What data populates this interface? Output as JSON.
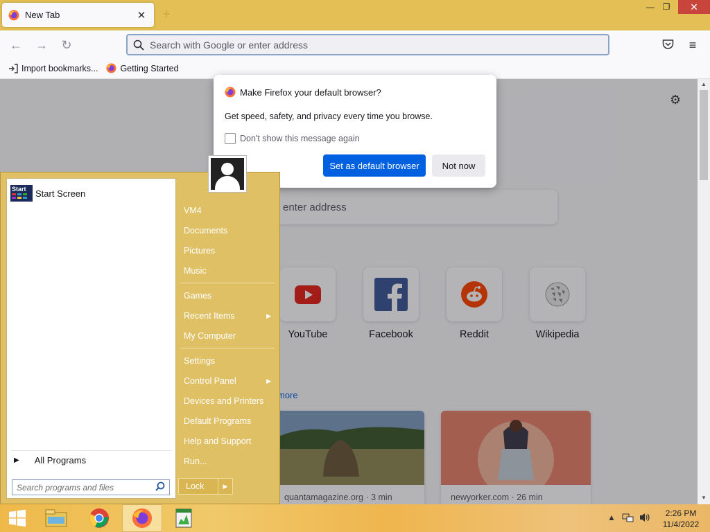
{
  "browser": {
    "tab_title": "New Tab",
    "tab_close": "✕",
    "new_tab": "+",
    "window_controls": {
      "minimize": "—",
      "restore": "❐",
      "close": "✕"
    },
    "nav": {
      "back": "←",
      "forward": "→",
      "reload": "↻",
      "pocket": "pocket-icon",
      "menu": "≡"
    },
    "urlbar_placeholder": "Search with Google or enter address",
    "bookmarks": [
      {
        "label": "Import bookmarks...",
        "icon": "import-icon"
      },
      {
        "label": "Getting Started",
        "icon": "firefox-icon"
      }
    ]
  },
  "newtab": {
    "search_placeholder": "enter address",
    "sites": [
      {
        "label": "YouTube",
        "color": "#e62117"
      },
      {
        "label": "Facebook",
        "color": "#3b5998"
      },
      {
        "label": "Reddit",
        "color": "#ff4500"
      },
      {
        "label": "Wikipedia",
        "color": "#777777"
      }
    ],
    "more_link": "more",
    "cards": [
      {
        "source": "quantamagazine.org · 3 min"
      },
      {
        "source": "newyorker.com · 26 min"
      }
    ]
  },
  "dialog": {
    "title": "Make Firefox your default browser?",
    "body": "Get speed, safety, and privacy every time you browse.",
    "checkbox_label": "Don't show this message again",
    "primary_button": "Set as default browser",
    "secondary_button": "Not now"
  },
  "start_menu": {
    "pinned": [
      {
        "label": "Start Screen",
        "tile_text": "Start"
      }
    ],
    "all_programs": "All Programs",
    "search_placeholder": "Search programs and files",
    "right_items": [
      {
        "label": "VM4",
        "has_submenu": false
      },
      {
        "label": "Documents",
        "has_submenu": false
      },
      {
        "label": "Pictures",
        "has_submenu": false
      },
      {
        "label": "Music",
        "has_submenu": false
      },
      {
        "label": "Games",
        "has_submenu": false
      },
      {
        "label": "Recent Items",
        "has_submenu": true
      },
      {
        "label": "My Computer",
        "has_submenu": false
      },
      {
        "label": "Settings",
        "has_submenu": false
      },
      {
        "label": "Control Panel",
        "has_submenu": true
      },
      {
        "label": "Devices and Printers",
        "has_submenu": false
      },
      {
        "label": "Default Programs",
        "has_submenu": false
      },
      {
        "label": "Help and Support",
        "has_submenu": false
      },
      {
        "label": "Run...",
        "has_submenu": false
      }
    ],
    "lock_label": "Lock"
  },
  "taskbar": {
    "apps": [
      "start-icon",
      "file-explorer-icon",
      "chrome-icon",
      "firefox-icon",
      "task-manager-icon"
    ],
    "time": "2:26 PM",
    "date": "11/4/2022"
  },
  "colors": {
    "accent": "#0061e0",
    "taskbar": "#efb94a",
    "start_menu": "#e0c064"
  }
}
